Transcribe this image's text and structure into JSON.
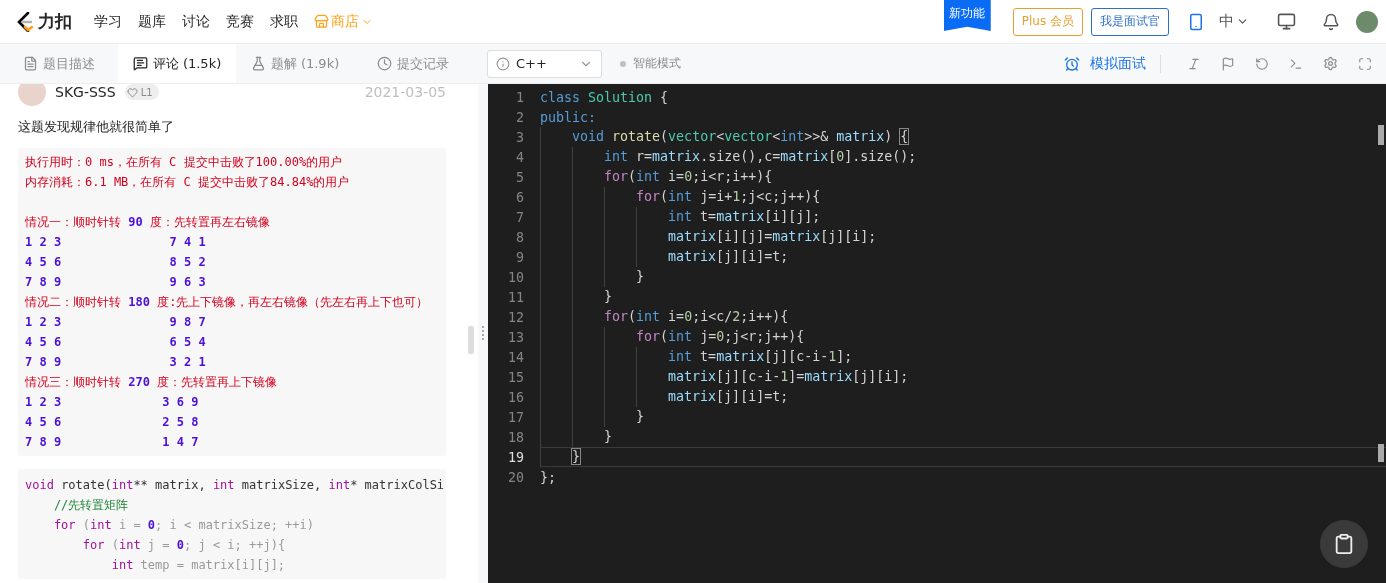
{
  "nav": {
    "logo": "力扣",
    "items": [
      {
        "label": "学习",
        "kind": "link"
      },
      {
        "label": "题库",
        "kind": "link"
      },
      {
        "label": "讨论",
        "kind": "link"
      },
      {
        "label": "竞赛",
        "kind": "link"
      },
      {
        "label": "求职",
        "kind": "link"
      },
      {
        "label": "商店",
        "kind": "shop"
      }
    ],
    "ribbon": "新功能",
    "plus_button": "Plus 会员",
    "interviewer_button": "我是面试官",
    "language": {
      "label": "中",
      "expanded": false
    }
  },
  "tabs": [
    {
      "label": "题目描述",
      "selected": false
    },
    {
      "label": "评论 (1.5k)",
      "selected": true
    },
    {
      "label": "题解 (1.9k)",
      "selected": false
    },
    {
      "label": "提交记录",
      "selected": false
    }
  ],
  "language_select": {
    "value": "C++"
  },
  "smart_mode": {
    "label": "智能模式",
    "on": false
  },
  "toolbar": {
    "mock_interview": "模拟面试"
  },
  "comment": {
    "author": "SKG-SSS",
    "badge": "L1",
    "date": "2021-03-05",
    "text": "这题发现规律他就很简单了",
    "result_block": [
      {
        "kind": "text",
        "tokens": [
          {
            "kind": "red",
            "text": "执行用时：0 ms，在所有 C 提交中击败了100.00%的用户"
          }
        ]
      },
      {
        "kind": "text",
        "tokens": [
          {
            "kind": "red",
            "text": "内存消耗：6.1 MB，在所有 C 提交中击败了84.84%的用户"
          }
        ]
      },
      {
        "kind": "blank"
      },
      {
        "kind": "text",
        "tokens": [
          {
            "kind": "red",
            "text": "情况一：顺时针转 "
          },
          {
            "kind": "num",
            "text": "90"
          },
          {
            "kind": "red",
            "text": " 度：先转置再左右镜像"
          }
        ]
      },
      {
        "kind": "text",
        "tokens": [
          {
            "kind": "num",
            "text": "1 2 3               7 4 1"
          }
        ]
      },
      {
        "kind": "text",
        "tokens": [
          {
            "kind": "num",
            "text": "4 5 6               8 5 2"
          }
        ]
      },
      {
        "kind": "text",
        "tokens": [
          {
            "kind": "num",
            "text": "7 8 9               9 6 3"
          }
        ]
      },
      {
        "kind": "text",
        "tokens": [
          {
            "kind": "red",
            "text": "情况二：顺时针转 "
          },
          {
            "kind": "num",
            "text": "180"
          },
          {
            "kind": "red",
            "text": " 度:先上下镜像，再左右镜像（先左右再上下也可）"
          }
        ]
      },
      {
        "kind": "text",
        "tokens": [
          {
            "kind": "num",
            "text": "1 2 3               9 8 7"
          }
        ]
      },
      {
        "kind": "text",
        "tokens": [
          {
            "kind": "num",
            "text": "4 5 6               6 5 4"
          }
        ]
      },
      {
        "kind": "text",
        "tokens": [
          {
            "kind": "num",
            "text": "7 8 9               3 2 1"
          }
        ]
      },
      {
        "kind": "text",
        "tokens": [
          {
            "kind": "red",
            "text": "情况三：顺时针转 "
          },
          {
            "kind": "num",
            "text": "270"
          },
          {
            "kind": "red",
            "text": " 度：先转置再上下镜像"
          }
        ]
      },
      {
        "kind": "text",
        "tokens": [
          {
            "kind": "num",
            "text": "1 2 3              3 6 9"
          }
        ]
      },
      {
        "kind": "text",
        "tokens": [
          {
            "kind": "num",
            "text": "4 5 6              2 5 8"
          }
        ]
      },
      {
        "kind": "text",
        "tokens": [
          {
            "kind": "num",
            "text": "7 8 9              1 4 7"
          }
        ]
      }
    ],
    "code_block": [
      [
        {
          "kind": "kw",
          "text": "void"
        },
        {
          "kind": "id",
          "text": " rotate("
        },
        {
          "kind": "kw",
          "text": "int"
        },
        {
          "kind": "id",
          "text": "** matrix, "
        },
        {
          "kind": "kw",
          "text": "int"
        },
        {
          "kind": "id",
          "text": " matrixSize, "
        },
        {
          "kind": "kw",
          "text": "int"
        },
        {
          "kind": "id",
          "text": "* matrixColSi"
        }
      ],
      [
        {
          "kind": "cm",
          "text": "    //先转置矩阵"
        }
      ],
      [
        {
          "kind": "kw",
          "text": "    for"
        },
        {
          "kind": "p",
          "text": " ("
        },
        {
          "kind": "kw",
          "text": "int"
        },
        {
          "kind": "p",
          "text": " i = "
        },
        {
          "kind": "num",
          "text": "0"
        },
        {
          "kind": "p",
          "text": "; i < matrixSize; ++i)"
        }
      ],
      [
        {
          "kind": "kw",
          "text": "        for"
        },
        {
          "kind": "p",
          "text": " ("
        },
        {
          "kind": "kw",
          "text": "int"
        },
        {
          "kind": "p",
          "text": " j = "
        },
        {
          "kind": "num",
          "text": "0"
        },
        {
          "kind": "p",
          "text": "; j < i; ++j){"
        }
      ],
      [
        {
          "kind": "kw",
          "text": "            int"
        },
        {
          "kind": "p",
          "text": " temp = matrix[i][j];"
        }
      ]
    ]
  },
  "editor": {
    "lines": [
      {
        "number": "1",
        "active": false,
        "tokens": [
          {
            "kind": "kw",
            "text": "class"
          },
          {
            "kind": "type",
            "text": " Solution"
          },
          {
            "kind": "p",
            "text": " {"
          }
        ]
      },
      {
        "number": "2",
        "active": false,
        "tokens": [
          {
            "kind": "kw",
            "text": "public:"
          }
        ]
      },
      {
        "number": "3",
        "active": false,
        "tokens": [
          {
            "kind": "kw",
            "text": "    void"
          },
          {
            "kind": "fn",
            "text": " rotate"
          },
          {
            "kind": "p",
            "text": "("
          },
          {
            "kind": "type",
            "text": "vector"
          },
          {
            "kind": "p",
            "text": "<"
          },
          {
            "kind": "type",
            "text": "vector"
          },
          {
            "kind": "p",
            "text": "<"
          },
          {
            "kind": "kw",
            "text": "int"
          },
          {
            "kind": "p",
            "text": ">>& "
          },
          {
            "kind": "var",
            "text": "matrix"
          },
          {
            "kind": "p",
            "text": ") "
          },
          {
            "kind": "match",
            "text": "{"
          }
        ]
      },
      {
        "number": "4",
        "active": false,
        "tokens": [
          {
            "kind": "kw",
            "text": "        int"
          },
          {
            "kind": "p",
            "text": " r="
          },
          {
            "kind": "var",
            "text": "matrix"
          },
          {
            "kind": "p",
            "text": ".size(),c="
          },
          {
            "kind": "var",
            "text": "matrix"
          },
          {
            "kind": "p",
            "text": "["
          },
          {
            "kind": "num",
            "text": "0"
          },
          {
            "kind": "p",
            "text": "].size();"
          }
        ]
      },
      {
        "number": "5",
        "active": false,
        "tokens": [
          {
            "kind": "ctl",
            "text": "        for"
          },
          {
            "kind": "p",
            "text": "("
          },
          {
            "kind": "kw",
            "text": "int"
          },
          {
            "kind": "p",
            "text": " i="
          },
          {
            "kind": "num",
            "text": "0"
          },
          {
            "kind": "p",
            "text": ";i<r;i++){"
          }
        ]
      },
      {
        "number": "6",
        "active": false,
        "tokens": [
          {
            "kind": "ctl",
            "text": "            for"
          },
          {
            "kind": "p",
            "text": "("
          },
          {
            "kind": "kw",
            "text": "int"
          },
          {
            "kind": "p",
            "text": " j=i+"
          },
          {
            "kind": "num",
            "text": "1"
          },
          {
            "kind": "p",
            "text": ";j<c;j++){"
          }
        ]
      },
      {
        "number": "7",
        "active": false,
        "tokens": [
          {
            "kind": "kw",
            "text": "                int"
          },
          {
            "kind": "p",
            "text": " t="
          },
          {
            "kind": "var",
            "text": "matrix"
          },
          {
            "kind": "p",
            "text": "[i][j];"
          }
        ]
      },
      {
        "number": "8",
        "active": false,
        "tokens": [
          {
            "kind": "var",
            "text": "                matrix"
          },
          {
            "kind": "p",
            "text": "[i][j]="
          },
          {
            "kind": "var",
            "text": "matrix"
          },
          {
            "kind": "p",
            "text": "[j][i];"
          }
        ]
      },
      {
        "number": "9",
        "active": false,
        "tokens": [
          {
            "kind": "var",
            "text": "                matrix"
          },
          {
            "kind": "p",
            "text": "[j][i]=t;"
          }
        ]
      },
      {
        "number": "10",
        "active": false,
        "tokens": [
          {
            "kind": "p",
            "text": "            }"
          }
        ]
      },
      {
        "number": "11",
        "active": false,
        "tokens": [
          {
            "kind": "p",
            "text": "        }"
          }
        ]
      },
      {
        "number": "12",
        "active": false,
        "tokens": [
          {
            "kind": "ctl",
            "text": "        for"
          },
          {
            "kind": "p",
            "text": "("
          },
          {
            "kind": "kw",
            "text": "int"
          },
          {
            "kind": "p",
            "text": " i="
          },
          {
            "kind": "num",
            "text": "0"
          },
          {
            "kind": "p",
            "text": ";i<c/"
          },
          {
            "kind": "num",
            "text": "2"
          },
          {
            "kind": "p",
            "text": ";i++){"
          }
        ]
      },
      {
        "number": "13",
        "active": false,
        "tokens": [
          {
            "kind": "ctl",
            "text": "            for"
          },
          {
            "kind": "p",
            "text": "("
          },
          {
            "kind": "kw",
            "text": "int"
          },
          {
            "kind": "p",
            "text": " j="
          },
          {
            "kind": "num",
            "text": "0"
          },
          {
            "kind": "p",
            "text": ";j<r;j++){"
          }
        ]
      },
      {
        "number": "14",
        "active": false,
        "tokens": [
          {
            "kind": "kw",
            "text": "                int"
          },
          {
            "kind": "p",
            "text": " t="
          },
          {
            "kind": "var",
            "text": "matrix"
          },
          {
            "kind": "p",
            "text": "[j][c-i-"
          },
          {
            "kind": "num",
            "text": "1"
          },
          {
            "kind": "p",
            "text": "];"
          }
        ]
      },
      {
        "number": "15",
        "active": false,
        "tokens": [
          {
            "kind": "var",
            "text": "                matrix"
          },
          {
            "kind": "p",
            "text": "[j][c-i-"
          },
          {
            "kind": "num",
            "text": "1"
          },
          {
            "kind": "p",
            "text": "]="
          },
          {
            "kind": "var",
            "text": "matrix"
          },
          {
            "kind": "p",
            "text": "[j][i];"
          }
        ]
      },
      {
        "number": "16",
        "active": false,
        "tokens": [
          {
            "kind": "var",
            "text": "                matrix"
          },
          {
            "kind": "p",
            "text": "[j][i]=t;"
          }
        ]
      },
      {
        "number": "17",
        "active": false,
        "tokens": [
          {
            "kind": "p",
            "text": "            }"
          }
        ]
      },
      {
        "number": "18",
        "active": false,
        "tokens": [
          {
            "kind": "p",
            "text": "        }"
          }
        ]
      },
      {
        "number": "19",
        "active": true,
        "tokens": [
          {
            "kind": "match",
            "text": "    }"
          }
        ]
      },
      {
        "number": "20",
        "active": false,
        "tokens": [
          {
            "kind": "p",
            "text": "};"
          }
        ]
      }
    ]
  }
}
